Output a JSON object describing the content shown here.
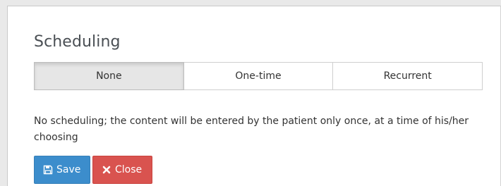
{
  "dialog": {
    "title": "Scheduling"
  },
  "scheduling_options": {
    "selected": "None",
    "items": [
      {
        "label": "None"
      },
      {
        "label": "One-time"
      },
      {
        "label": "Recurrent"
      }
    ]
  },
  "description": {
    "text": "No scheduling; the content will be entered by the patient only once, at a time of his/her choosing"
  },
  "actions": {
    "save_label": "Save",
    "save_icon": "floppy-disk-icon",
    "close_label": "Close",
    "close_icon": "x-icon"
  },
  "colors": {
    "save_button": "#3c8dcc",
    "close_button": "#d9534f",
    "selected_segment": "#e6e6e6"
  }
}
